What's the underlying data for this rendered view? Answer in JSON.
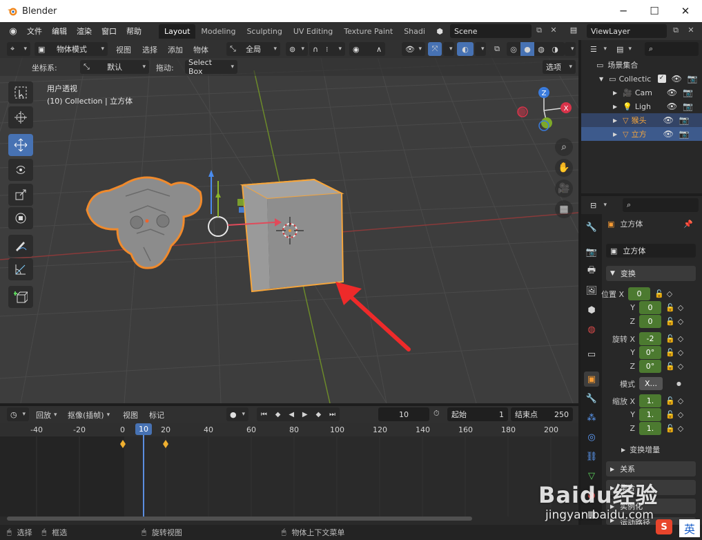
{
  "window": {
    "title": "Blender",
    "minimize": "─",
    "maximize": "☐",
    "close": "✕"
  },
  "menubar": {
    "items": [
      "文件",
      "编辑",
      "渲染",
      "窗口",
      "帮助"
    ],
    "workspaces": [
      "Layout",
      "Modeling",
      "Sculpting",
      "UV Editing",
      "Texture Paint",
      "Shadi"
    ],
    "active_workspace": "Layout",
    "scene": "Scene",
    "view_layer": "ViewLayer"
  },
  "viewport_header": {
    "mode": "物体模式",
    "menus": [
      "视图",
      "选择",
      "添加",
      "物体"
    ],
    "transform_orientation": "全局"
  },
  "viewport_sub": {
    "coord_label": "坐标系:",
    "coord_value": "默认",
    "drag_label": "拖动:",
    "drag_value": "Select Box",
    "options": "选项"
  },
  "viewport": {
    "view_name": "用户透视",
    "collection_info": "(10) Collection | 立方体"
  },
  "gizmo": {
    "x": "X",
    "y": "Y",
    "z": "Z"
  },
  "outliner": {
    "scene_collection": "场景集合",
    "items": [
      {
        "label": "Collectic",
        "selected": false
      },
      {
        "label": "Cam",
        "selected": false
      },
      {
        "label": "Ligh",
        "selected": false
      },
      {
        "label": "猴头",
        "selected": true
      },
      {
        "label": "立方",
        "selected": true
      }
    ]
  },
  "properties": {
    "object_name": "立方体",
    "data_name": "立方体",
    "transform_header": "变换",
    "location_label": "位置 X",
    "rotation_label": "旋转 X",
    "scale_label": "缩放 X",
    "axis_y": "Y",
    "axis_z": "Z",
    "location": [
      "0",
      "0",
      "0"
    ],
    "rotation": [
      "-2",
      "0°",
      "0°"
    ],
    "mode_label": "模式",
    "mode_value": "X...",
    "scale": [
      "1.",
      "1.",
      "1."
    ],
    "delta_label": "变换增量",
    "relations": "关系",
    "collections": "集合",
    "instancing": "实例化",
    "motion_paths": "运动路径"
  },
  "timeline": {
    "playback": "回放",
    "keying": "抠像(插帧)",
    "view": "视图",
    "marker": "标记",
    "current_frame": "10",
    "start_label": "起始",
    "start_value": "1",
    "end_label": "结束点",
    "end_value": "250",
    "ruler": [
      "-40",
      "-20",
      "0",
      "20",
      "40",
      "60",
      "80",
      "100",
      "120",
      "140",
      "160",
      "180",
      "200"
    ],
    "playhead": "10"
  },
  "statusbar": {
    "select": "选择",
    "box": "框选",
    "rotate": "旋转视图",
    "context": "物体上下文菜单"
  },
  "watermark": {
    "text": "Baidu经验",
    "url": "jingyan.baidu.com",
    "ime": "英"
  },
  "colors": {
    "accent": "#4772b3",
    "selection": "#f59a33",
    "active_green": "#4c7a30"
  }
}
